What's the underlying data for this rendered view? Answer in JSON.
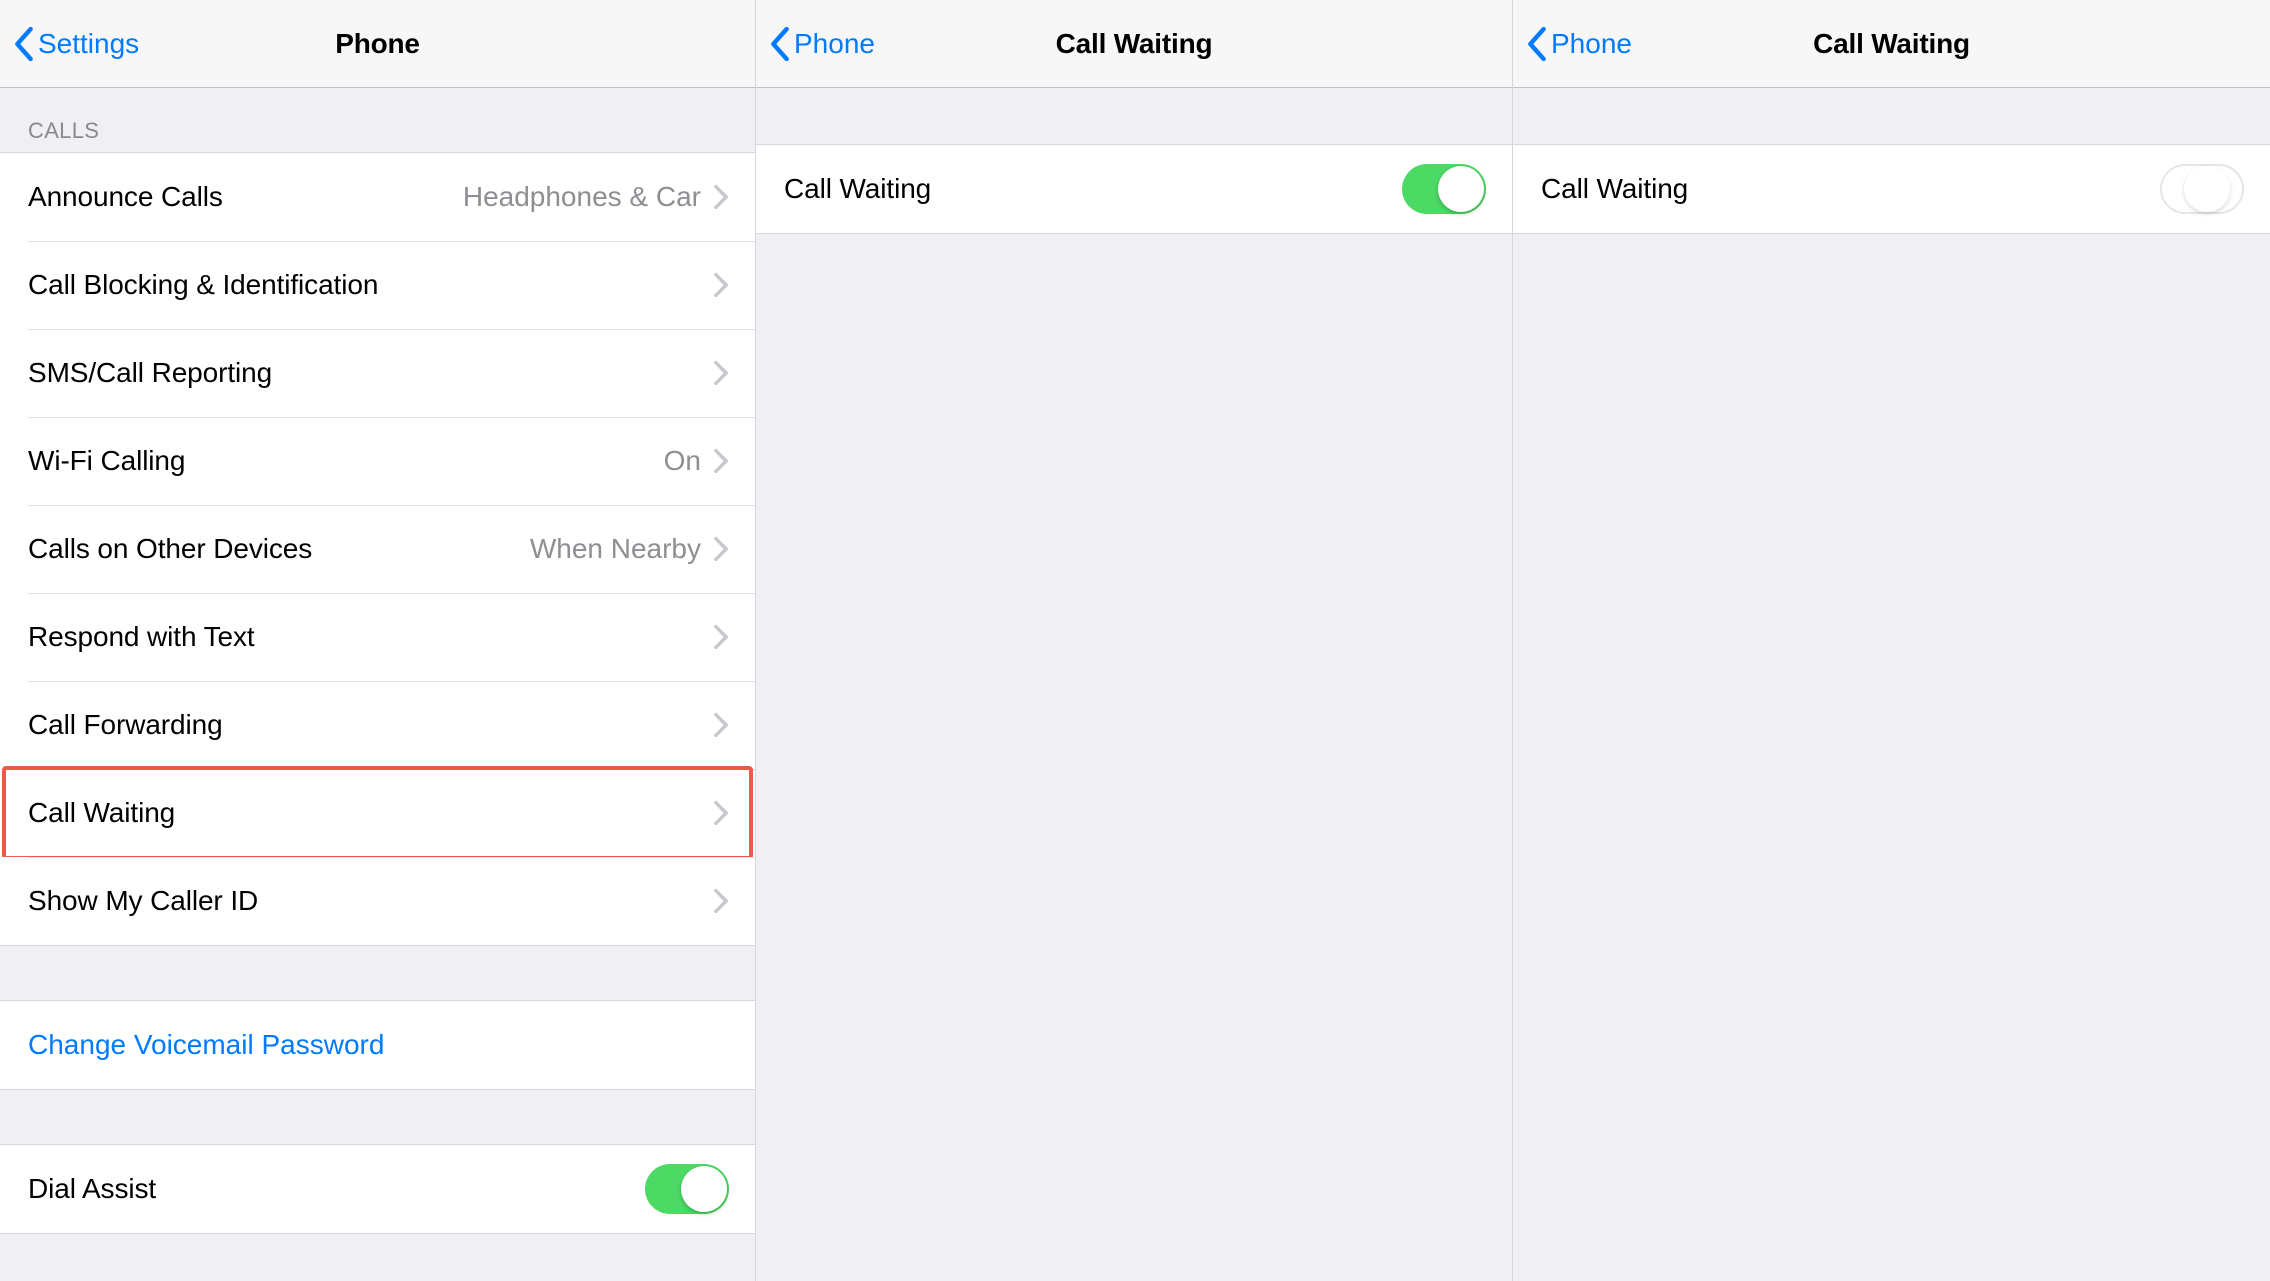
{
  "colors": {
    "ios_blue": "#007aff",
    "ios_green": "#4cd964",
    "highlight_red": "#ec5a4a"
  },
  "screen1": {
    "nav": {
      "back": "Settings",
      "title": "Phone"
    },
    "section_header": "CALLS",
    "rows": [
      {
        "label": "Announce Calls",
        "value": "Headphones & Car"
      },
      {
        "label": "Call Blocking & Identification"
      },
      {
        "label": "SMS/Call Reporting"
      },
      {
        "label": "Wi-Fi Calling",
        "value": "On"
      },
      {
        "label": "Calls on Other Devices",
        "value": "When Nearby"
      },
      {
        "label": "Respond with Text"
      },
      {
        "label": "Call Forwarding"
      },
      {
        "label": "Call Waiting",
        "highlighted": true
      },
      {
        "label": "Show My Caller ID"
      }
    ],
    "voicemail_row": {
      "label": "Change Voicemail Password"
    },
    "dial_assist_row": {
      "label": "Dial Assist",
      "toggle_on": true
    }
  },
  "screen2": {
    "nav": {
      "back": "Phone",
      "title": "Call Waiting"
    },
    "row": {
      "label": "Call Waiting",
      "toggle_state": "on"
    }
  },
  "screen3": {
    "nav": {
      "back": "Phone",
      "title": "Call Waiting"
    },
    "row": {
      "label": "Call Waiting",
      "toggle_state": "loading"
    }
  }
}
